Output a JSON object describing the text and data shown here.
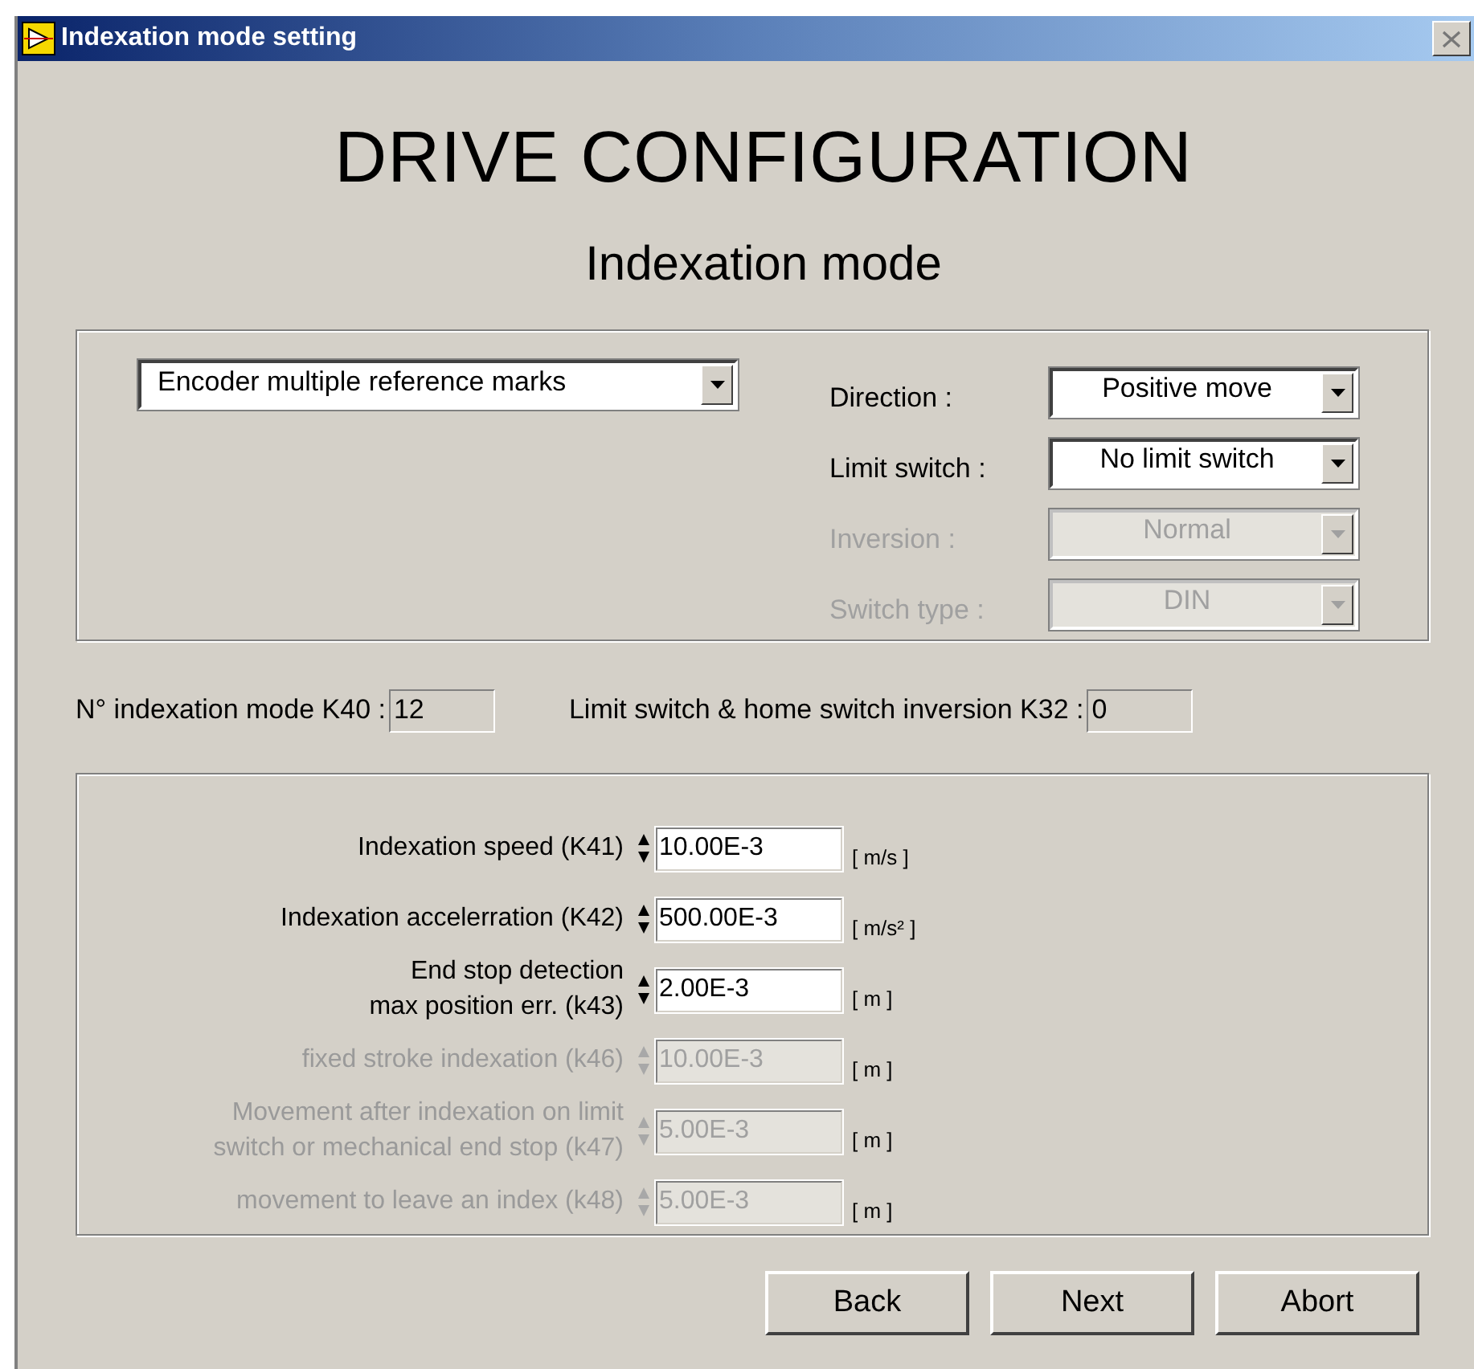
{
  "window": {
    "title": "Indexation mode setting"
  },
  "heading": "DRIVE CONFIGURATION",
  "subheading": "Indexation mode",
  "mode_select": {
    "value": "Encoder multiple reference marks",
    "disabled": false
  },
  "settings": [
    {
      "label": "Direction :",
      "value": "Positive move",
      "disabled": false
    },
    {
      "label": "Limit switch :",
      "value": "No limit switch",
      "disabled": false
    },
    {
      "label": "Inversion :",
      "value": "Normal",
      "disabled": true
    },
    {
      "label": "Switch type :",
      "value": "DIN",
      "disabled": true
    }
  ],
  "codes": [
    {
      "label": "N° indexation mode K40 :",
      "value": "12"
    },
    {
      "label": "Limit switch & home switch inversion K32 :",
      "value": "0"
    }
  ],
  "parameters": [
    {
      "label": [
        "Indexation speed (K41)"
      ],
      "value": "10.00E-3",
      "unit": "[ m/s ]",
      "disabled": false
    },
    {
      "label": [
        "Indexation accelerration (K42)"
      ],
      "value": "500.00E-3",
      "unit": "[ m/s² ]",
      "disabled": false
    },
    {
      "label": [
        "End stop detection",
        "max position err. (k43)"
      ],
      "value": "2.00E-3",
      "unit": "[ m ]",
      "disabled": false
    },
    {
      "label": [
        "fixed stroke indexation (k46)"
      ],
      "value": "10.00E-3",
      "unit": "[ m ]",
      "disabled": true
    },
    {
      "label": [
        "Movement after indexation on limit",
        "switch or mechanical end stop (k47)"
      ],
      "value": "5.00E-3",
      "unit": "[ m ]",
      "disabled": true
    },
    {
      "label": [
        "movement to leave an index (k48)"
      ],
      "value": "5.00E-3",
      "unit": "[ m ]",
      "disabled": true
    }
  ],
  "buttons": [
    "Back",
    "Next",
    "Abort"
  ]
}
